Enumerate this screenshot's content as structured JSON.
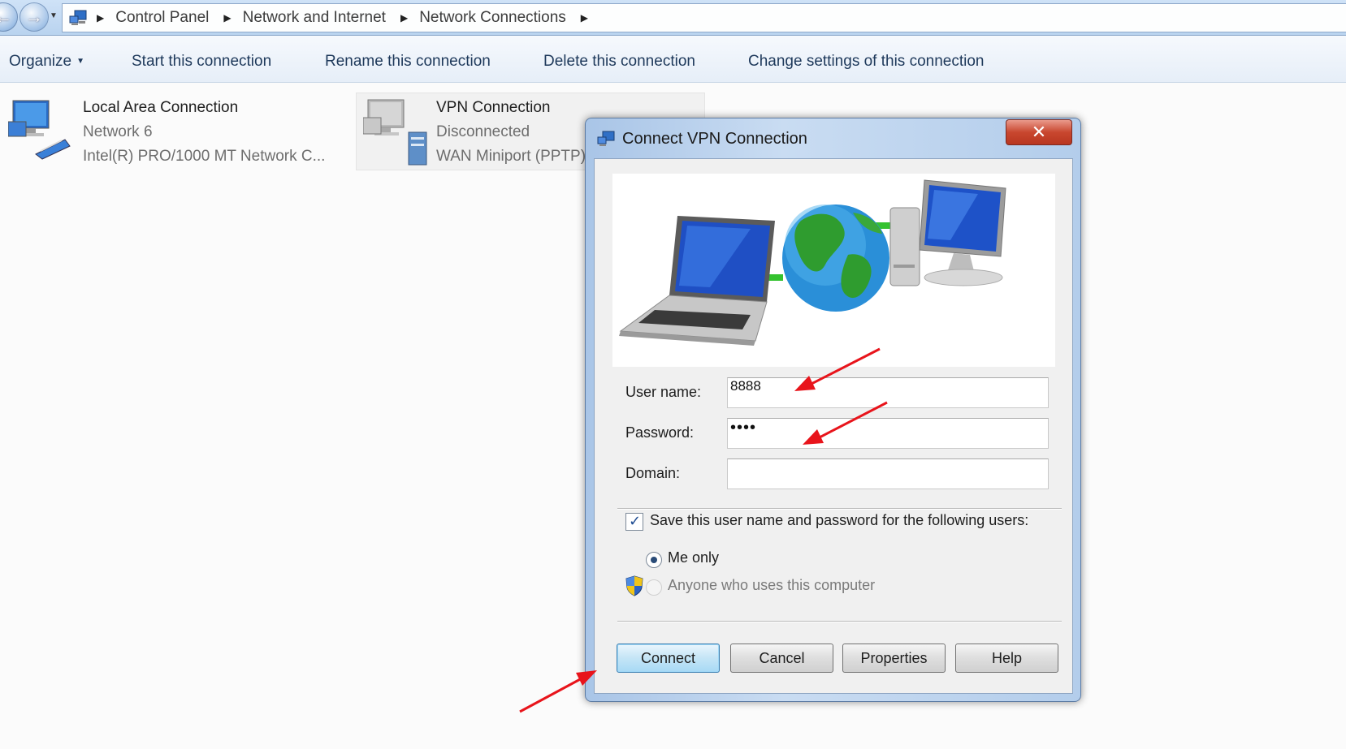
{
  "breadcrumb": {
    "items": [
      "Control Panel",
      "Network and Internet",
      "Network Connections"
    ]
  },
  "toolbar": {
    "organize": "Organize",
    "start": "Start this connection",
    "rename": "Rename this connection",
    "delete": "Delete this connection",
    "change": "Change settings of this connection"
  },
  "connections": [
    {
      "name": "Local Area Connection",
      "status": "Network  6",
      "device": "Intel(R) PRO/1000 MT Network C..."
    },
    {
      "name": "VPN Connection",
      "status": "Disconnected",
      "device": "WAN Miniport (PPTP)"
    }
  ],
  "dialog": {
    "title": "Connect VPN Connection",
    "username_label": "User name:",
    "username_value": "8888",
    "password_label": "Password:",
    "password_value": "••••",
    "domain_label": "Domain:",
    "domain_value": "",
    "save_label": "Save this user name and password for the following users:",
    "save_checked": true,
    "me_only": "Me only",
    "anyone": "Anyone who uses this computer",
    "buttons": {
      "connect": "Connect",
      "cancel": "Cancel",
      "properties": "Properties",
      "help": "Help"
    }
  },
  "colors": {
    "annotation_arrow": "#e8141b",
    "close_button": "#c9472f",
    "title_bar": "#c9dcf2"
  }
}
